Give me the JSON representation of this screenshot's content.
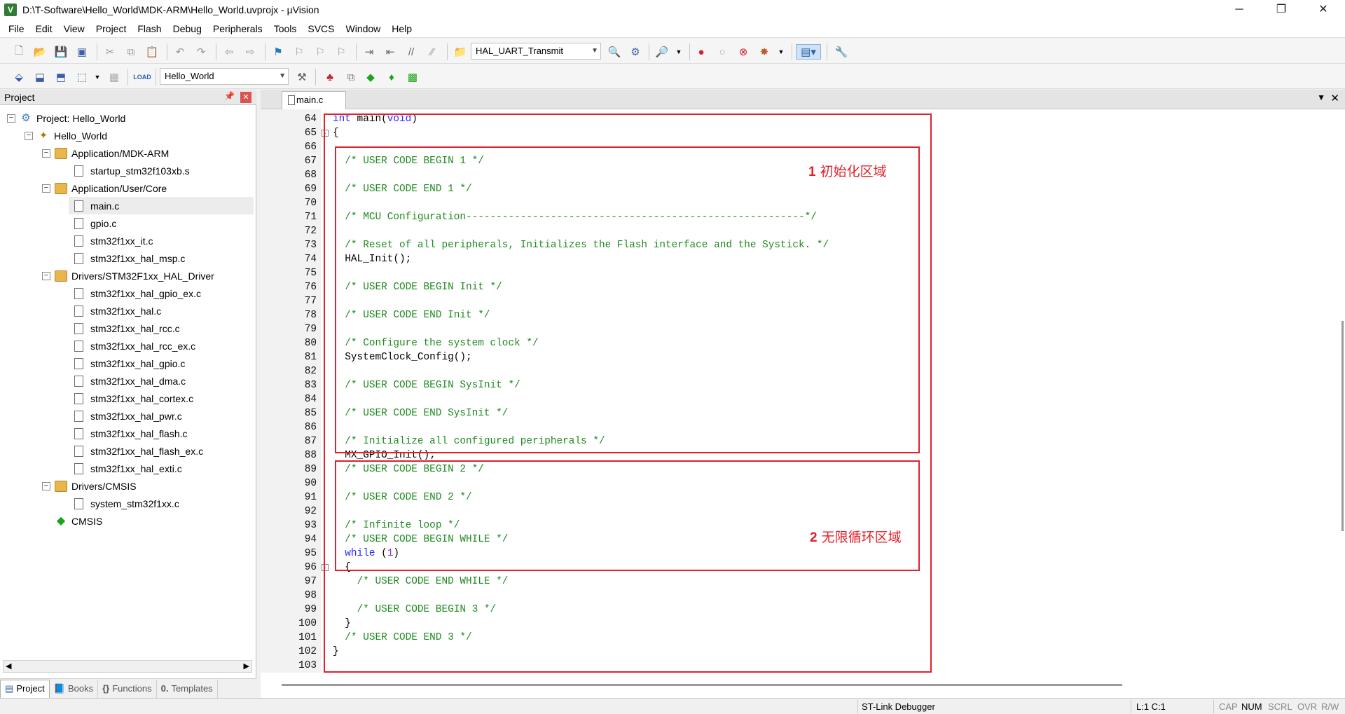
{
  "window": {
    "title": "D:\\T-Software\\Hello_World\\MDK-ARM\\Hello_World.uvprojx - µVision",
    "app_icon": "V"
  },
  "menu": [
    "File",
    "Edit",
    "View",
    "Project",
    "Flash",
    "Debug",
    "Peripherals",
    "Tools",
    "SVCS",
    "Window",
    "Help"
  ],
  "toolbar": {
    "function_combo": "HAL_UART_Transmit",
    "target_combo": "Hello_World"
  },
  "project_panel": {
    "title": "Project",
    "tree": [
      {
        "label": "Project: Hello_World",
        "type": "project",
        "expanded": true
      },
      {
        "label": "Hello_World",
        "type": "target",
        "expanded": true
      },
      {
        "label": "Application/MDK-ARM",
        "type": "folder",
        "expanded": true
      },
      {
        "label": "startup_stm32f103xb.s",
        "type": "file"
      },
      {
        "label": "Application/User/Core",
        "type": "folder",
        "expanded": true
      },
      {
        "label": "main.c",
        "type": "file",
        "selected": true
      },
      {
        "label": "gpio.c",
        "type": "file"
      },
      {
        "label": "stm32f1xx_it.c",
        "type": "file"
      },
      {
        "label": "stm32f1xx_hal_msp.c",
        "type": "file"
      },
      {
        "label": "Drivers/STM32F1xx_HAL_Driver",
        "type": "folder",
        "expanded": true
      },
      {
        "label": "stm32f1xx_hal_gpio_ex.c",
        "type": "file"
      },
      {
        "label": "stm32f1xx_hal.c",
        "type": "file"
      },
      {
        "label": "stm32f1xx_hal_rcc.c",
        "type": "file"
      },
      {
        "label": "stm32f1xx_hal_rcc_ex.c",
        "type": "file"
      },
      {
        "label": "stm32f1xx_hal_gpio.c",
        "type": "file"
      },
      {
        "label": "stm32f1xx_hal_dma.c",
        "type": "file"
      },
      {
        "label": "stm32f1xx_hal_cortex.c",
        "type": "file"
      },
      {
        "label": "stm32f1xx_hal_pwr.c",
        "type": "file"
      },
      {
        "label": "stm32f1xx_hal_flash.c",
        "type": "file"
      },
      {
        "label": "stm32f1xx_hal_flash_ex.c",
        "type": "file"
      },
      {
        "label": "stm32f1xx_hal_exti.c",
        "type": "file"
      },
      {
        "label": "Drivers/CMSIS",
        "type": "folder",
        "expanded": true
      },
      {
        "label": "system_stm32f1xx.c",
        "type": "file"
      },
      {
        "label": "CMSIS",
        "type": "component"
      }
    ],
    "tabs": [
      "Project",
      "Books",
      "Functions",
      "Templates"
    ]
  },
  "editor": {
    "tab": "main.c",
    "lines": [
      {
        "n": "64",
        "html": "<span class=\"kw\">int</span> main(<span class=\"kw\">void</span>)"
      },
      {
        "n": "65",
        "html": "{",
        "fold": "-"
      },
      {
        "n": "66",
        "html": ""
      },
      {
        "n": "67",
        "html": "  <span class=\"cm\">/* USER CODE BEGIN 1 */</span>"
      },
      {
        "n": "68",
        "html": ""
      },
      {
        "n": "69",
        "html": "  <span class=\"cm\">/* USER CODE END 1 */</span>"
      },
      {
        "n": "70",
        "html": ""
      },
      {
        "n": "71",
        "html": "  <span class=\"cm\">/* MCU Configuration--------------------------------------------------------*/</span>"
      },
      {
        "n": "72",
        "html": ""
      },
      {
        "n": "73",
        "html": "  <span class=\"cm\">/* Reset of all peripherals, Initializes the Flash interface and the Systick. */</span>"
      },
      {
        "n": "74",
        "html": "  HAL_Init();"
      },
      {
        "n": "75",
        "html": ""
      },
      {
        "n": "76",
        "html": "  <span class=\"cm\">/* USER CODE BEGIN Init */</span>"
      },
      {
        "n": "77",
        "html": ""
      },
      {
        "n": "78",
        "html": "  <span class=\"cm\">/* USER CODE END Init */</span>"
      },
      {
        "n": "79",
        "html": ""
      },
      {
        "n": "80",
        "html": "  <span class=\"cm\">/* Configure the system clock */</span>"
      },
      {
        "n": "81",
        "html": "  SystemClock_Config();"
      },
      {
        "n": "82",
        "html": ""
      },
      {
        "n": "83",
        "html": "  <span class=\"cm\">/* USER CODE BEGIN SysInit */</span>"
      },
      {
        "n": "84",
        "html": ""
      },
      {
        "n": "85",
        "html": "  <span class=\"cm\">/* USER CODE END SysInit */</span>"
      },
      {
        "n": "86",
        "html": ""
      },
      {
        "n": "87",
        "html": "  <span class=\"cm\">/* Initialize all configured peripherals */</span>"
      },
      {
        "n": "88",
        "html": "  MX_GPIO_Init();"
      },
      {
        "n": "89",
        "html": "  <span class=\"cm\">/* USER CODE BEGIN 2 */</span>"
      },
      {
        "n": "90",
        "html": ""
      },
      {
        "n": "91",
        "html": "  <span class=\"cm\">/* USER CODE END 2 */</span>"
      },
      {
        "n": "92",
        "html": ""
      },
      {
        "n": "93",
        "html": "  <span class=\"cm\">/* Infinite loop */</span>"
      },
      {
        "n": "94",
        "html": "  <span class=\"cm\">/* USER CODE BEGIN WHILE */</span>"
      },
      {
        "n": "95",
        "html": "  <span class=\"kw\">while</span> (<span class=\"num\">1</span>)"
      },
      {
        "n": "96",
        "html": "  {",
        "fold": "-"
      },
      {
        "n": "97",
        "html": "    <span class=\"cm\">/* USER CODE END WHILE */</span>"
      },
      {
        "n": "98",
        "html": ""
      },
      {
        "n": "99",
        "html": "    <span class=\"cm\">/* USER CODE BEGIN 3 */</span>"
      },
      {
        "n": "100",
        "html": "  }"
      },
      {
        "n": "101",
        "html": "  <span class=\"cm\">/* USER CODE END 3 */</span>"
      },
      {
        "n": "102",
        "html": "}"
      },
      {
        "n": "103",
        "html": ""
      }
    ],
    "annotations": {
      "init_region_num": "1",
      "init_region_text": "初始化区域",
      "loop_region_num": "2",
      "loop_region_text": "无限循环区域"
    },
    "annotation_color": "#e0202a"
  },
  "status": {
    "debugger": "ST-Link Debugger",
    "cursor": "L:1 C:1",
    "indicators": [
      "CAP",
      "NUM",
      "SCRL",
      "OVR",
      "R/W"
    ]
  }
}
